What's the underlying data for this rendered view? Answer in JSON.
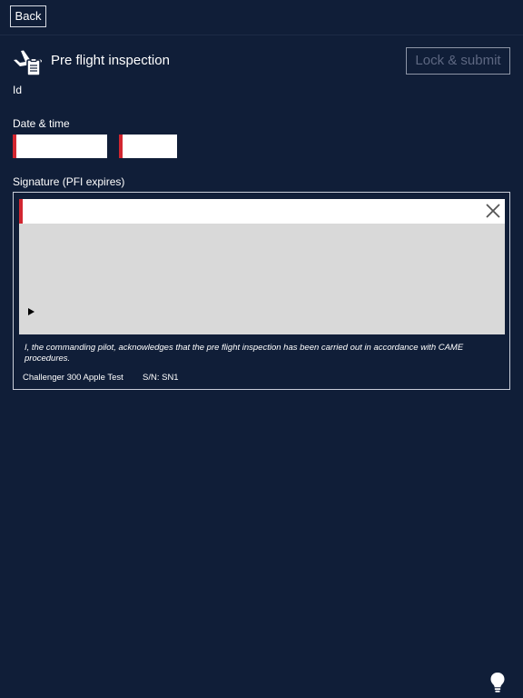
{
  "header": {
    "back_label": "Back",
    "title": "Pre flight inspection",
    "submit_label": "Lock & submit",
    "icon": "plane-clipboard-icon"
  },
  "form": {
    "id_label": "Id",
    "date_time_label": "Date & time",
    "date_value": "",
    "time_value": "",
    "signature_label": "Signature (PFI expires)"
  },
  "signature": {
    "name_value": "",
    "clear_icon": "close-icon",
    "disclaimer": "I, the commanding pilot, acknowledges that the pre flight inspection has been carried out in accordance with CAME procedures.",
    "aircraft_name": "Challenger 300 Apple Test",
    "aircraft_sn": "S/N: SN1"
  },
  "footer": {
    "icon": "lightbulb-icon"
  },
  "colors": {
    "background": "#101e38",
    "required_marker": "#d22630",
    "signature_pad": "#d9d9d9"
  }
}
